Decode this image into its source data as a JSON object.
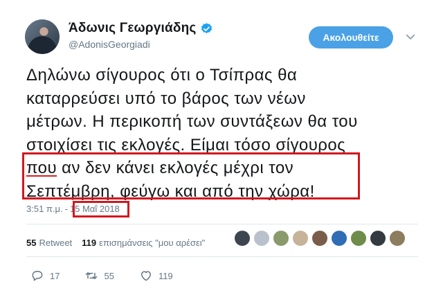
{
  "tweet": {
    "display_name": "Άδωνις Γεωργιάδης",
    "handle": "@AdonisGeorgiadi",
    "follow_label": "Ακολουθείτε",
    "lines": [
      "Δηλώνω σίγουρος ότι ο Τσίπρας θα",
      "καταρρεύσει υπό το βάρος των νέων",
      "μέτρων. Η περικοπή των συντάξεων θα του",
      "στοιχίσει τις εκλογές. Είμαι τόσο σίγουρος",
      "αν δεν κάνει εκλογές μέχρι τον",
      "Σεπτέμβρη, φεύγω και από την χώρα!"
    ],
    "underlined_word": "που",
    "time": "3:51 π.μ.",
    "date_separator": "-",
    "date": "15 Μαΐ 2018",
    "retweet_count": "55",
    "retweet_label": "Retweet",
    "like_count": "119",
    "like_label": "επισημάνσεις \"μου αρέσει\"",
    "actions": {
      "reply_count": "17",
      "retweet_count": "55",
      "like_count": "119"
    }
  },
  "colors": {
    "follow_button": "#4aa1e6",
    "highlight_box": "#d4161d",
    "verified": "#1da1f2",
    "muted_text": "#657786"
  },
  "likers": [
    {
      "icon": "wolf-avatar",
      "color": "#3d4650"
    },
    {
      "icon": "person-silhouette-avatar",
      "color": "#b9c2cc"
    },
    {
      "icon": "person-avatar",
      "color": "#8a9a6b"
    },
    {
      "icon": "person-avatar",
      "color": "#c7b29a"
    },
    {
      "icon": "person-avatar",
      "color": "#7a5c4a"
    },
    {
      "icon": "greek-flag-avatar",
      "color": "#2f6db5"
    },
    {
      "icon": "landscape-avatar",
      "color": "#6e8c4a"
    },
    {
      "icon": "person-avatar",
      "color": "#333a40"
    },
    {
      "icon": "person-avatar",
      "color": "#8c7d5e"
    }
  ]
}
